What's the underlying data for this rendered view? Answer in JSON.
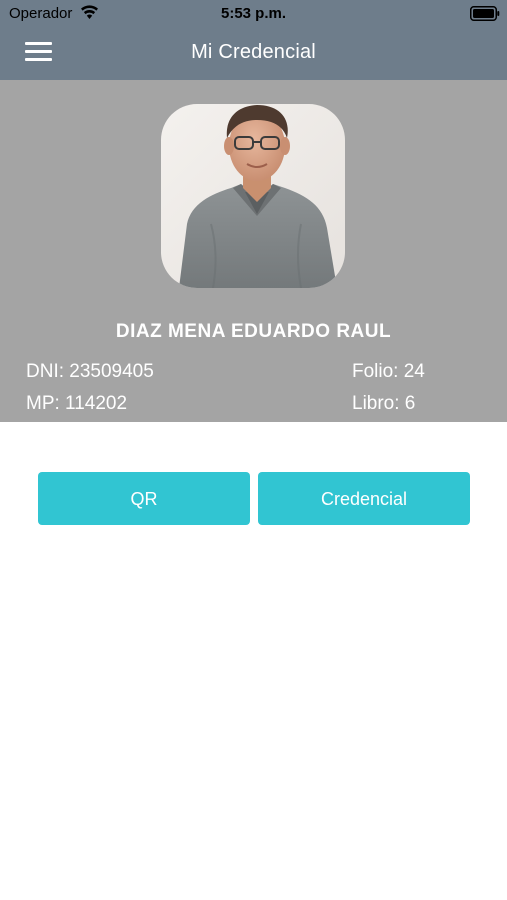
{
  "status_bar": {
    "carrier": "Operador",
    "time": "5:53 p.m.",
    "wifi_icon": "wifi-icon",
    "battery_icon": "battery-icon"
  },
  "nav": {
    "title": "Mi Credencial",
    "menu_icon": "hamburger-menu-icon"
  },
  "profile": {
    "name": "DIAZ MENA EDUARDO RAUL",
    "dni": "DNI: 23509405",
    "mp": "MP: 114202",
    "folio": "Folio: 24",
    "libro": "Libro: 6"
  },
  "actions": {
    "qr_label": "QR",
    "credential_label": "Credencial"
  },
  "colors": {
    "nav_background": "#6e7d8b",
    "profile_background": "#a4a4a4",
    "button_accent": "#31c5d2"
  }
}
